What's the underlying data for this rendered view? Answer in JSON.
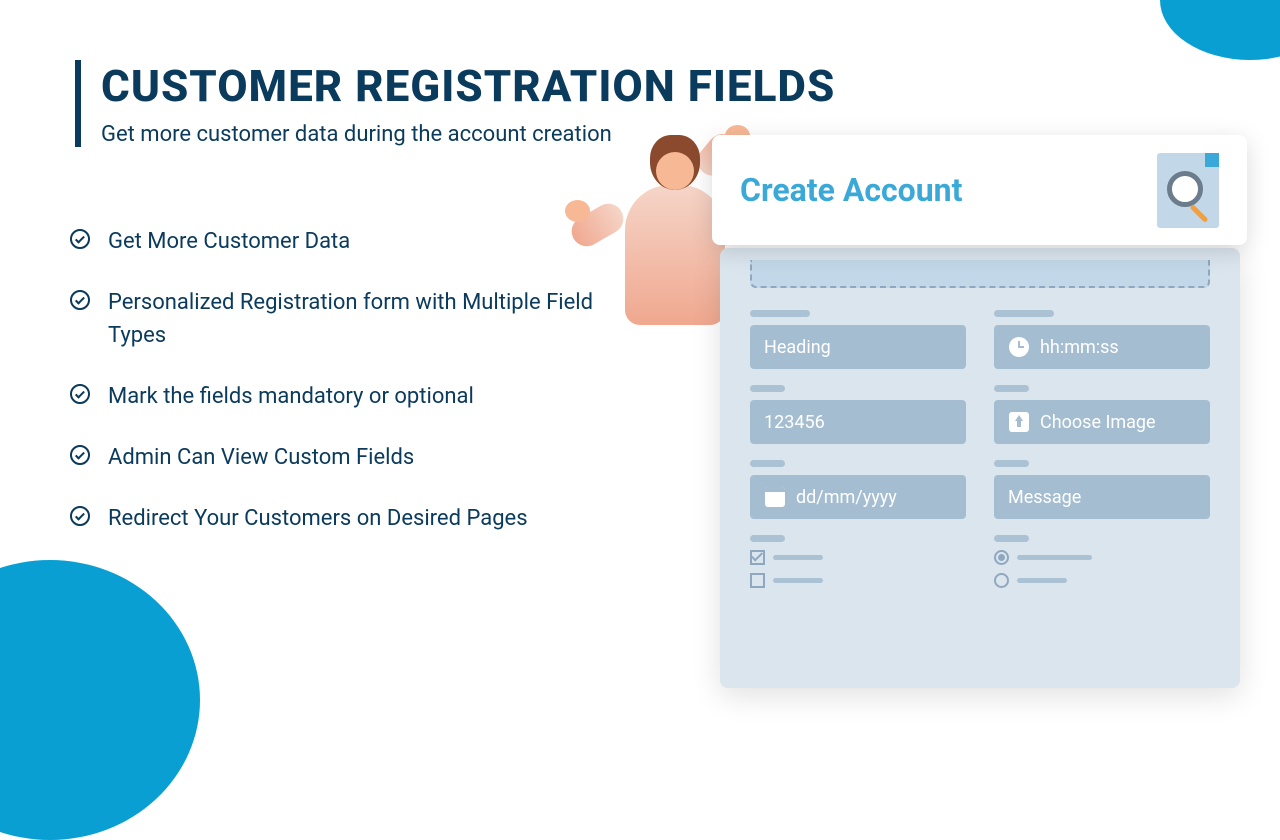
{
  "header": {
    "title": "CUSTOMER REGISTRATION FIELDS",
    "subtitle": "Get more customer data during the account creation"
  },
  "features": [
    "Get More Customer Data",
    "Personalized Registration form with Multiple Field Types",
    "Mark the fields mandatory or optional",
    "Admin Can  View Custom Fields",
    "Redirect Your Customers on Desired Pages"
  ],
  "mockup": {
    "card_title": "Create Account",
    "fields": {
      "heading": "Heading",
      "time": "hh:mm:ss",
      "number": "123456",
      "image": "Choose Image",
      "date": "dd/mm/yyyy",
      "message": "Message"
    }
  },
  "colors": {
    "accent": "#0a9fd3",
    "dark": "#0a3a5c",
    "bright": "#3ba9d8"
  }
}
